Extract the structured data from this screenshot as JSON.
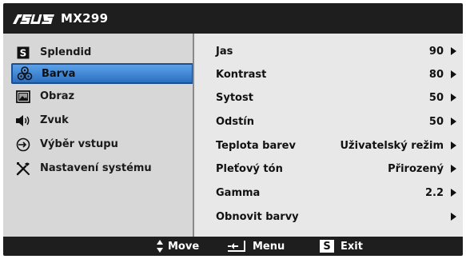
{
  "header": {
    "brand": "ASUS",
    "model": "MX299"
  },
  "sidebar": {
    "items": [
      {
        "label": "Splendid",
        "icon": "s-box-icon"
      },
      {
        "label": "Barva",
        "icon": "color-palette-icon",
        "selected": true
      },
      {
        "label": "Obraz",
        "icon": "picture-icon"
      },
      {
        "label": "Zvuk",
        "icon": "speaker-icon"
      },
      {
        "label": "Výběr vstupu",
        "icon": "input-select-icon"
      },
      {
        "label": "Nastavení systému",
        "icon": "tools-icon"
      }
    ]
  },
  "panel": {
    "rows": [
      {
        "label": "Jas",
        "value": "90"
      },
      {
        "label": "Kontrast",
        "value": "80"
      },
      {
        "label": "Sytost",
        "value": "50"
      },
      {
        "label": "Odstín",
        "value": "50"
      },
      {
        "label": "Teplota barev",
        "value": "Uživatelský režim"
      },
      {
        "label": "Pleťový tón",
        "value": "Přirozený"
      },
      {
        "label": "Gamma",
        "value": "2.2"
      },
      {
        "label": "Obnovit barvy",
        "value": ""
      }
    ]
  },
  "footer": {
    "move_label": "Move",
    "menu_label": "Menu",
    "exit_key": "S",
    "exit_label": "Exit"
  },
  "colors": {
    "selected_bg": "#3f86d6",
    "bar_bg": "#1e1e1e",
    "sidebar_bg": "#d7d7d7",
    "panel_bg": "#e8e8e8"
  }
}
